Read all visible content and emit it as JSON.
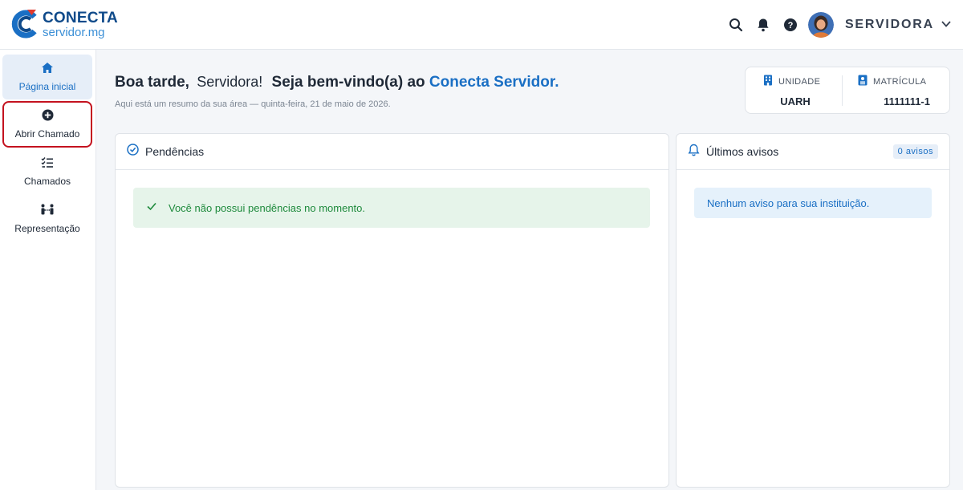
{
  "header": {
    "logo_title": "CONECTA",
    "logo_subtitle": "servidor.mg",
    "user_name": "SERVIDORA",
    "icons": [
      "search-icon",
      "bell-icon",
      "help-icon",
      "avatar",
      "chevron-down-icon"
    ]
  },
  "sidebar": {
    "items": [
      {
        "label": "Página inicial",
        "icon": "home-icon",
        "active": true
      },
      {
        "label": "Abrir Chamado",
        "icon": "plus-circle-icon",
        "highlighted": true
      },
      {
        "label": "Chamados",
        "icon": "checklist-icon"
      },
      {
        "label": "Representação",
        "icon": "people-icon"
      }
    ]
  },
  "main": {
    "greeting_prefix": "Boa tarde,",
    "greeting_name": "Servidora!",
    "greeting_mid": "Seja bem-vindo(a) ao",
    "greeting_brand": "Conecta Servidor.",
    "subtitle": "Aqui está um resumo da sua área — quinta-feira, 21 de maio de 2026.",
    "info": {
      "unidade_label": "UNIDADE",
      "unidade_value": "UARH",
      "matricula_label": "MATRÍCULA",
      "matricula_value": "1111111-1"
    },
    "pendencias": {
      "title": "Pendências",
      "message": "Você não possui pendências no momento."
    },
    "avisos": {
      "title": "Últimos avisos",
      "badge": "0 avisos",
      "message": "Nenhum aviso para sua instituição."
    }
  },
  "colors": {
    "brand_blue": "#1a6fc4",
    "dark_blue": "#0f4a8a",
    "highlight_red": "#c4121f",
    "success_green": "#1e8a3c",
    "success_bg": "#e6f4ea",
    "info_bg": "#e5f1fb"
  }
}
